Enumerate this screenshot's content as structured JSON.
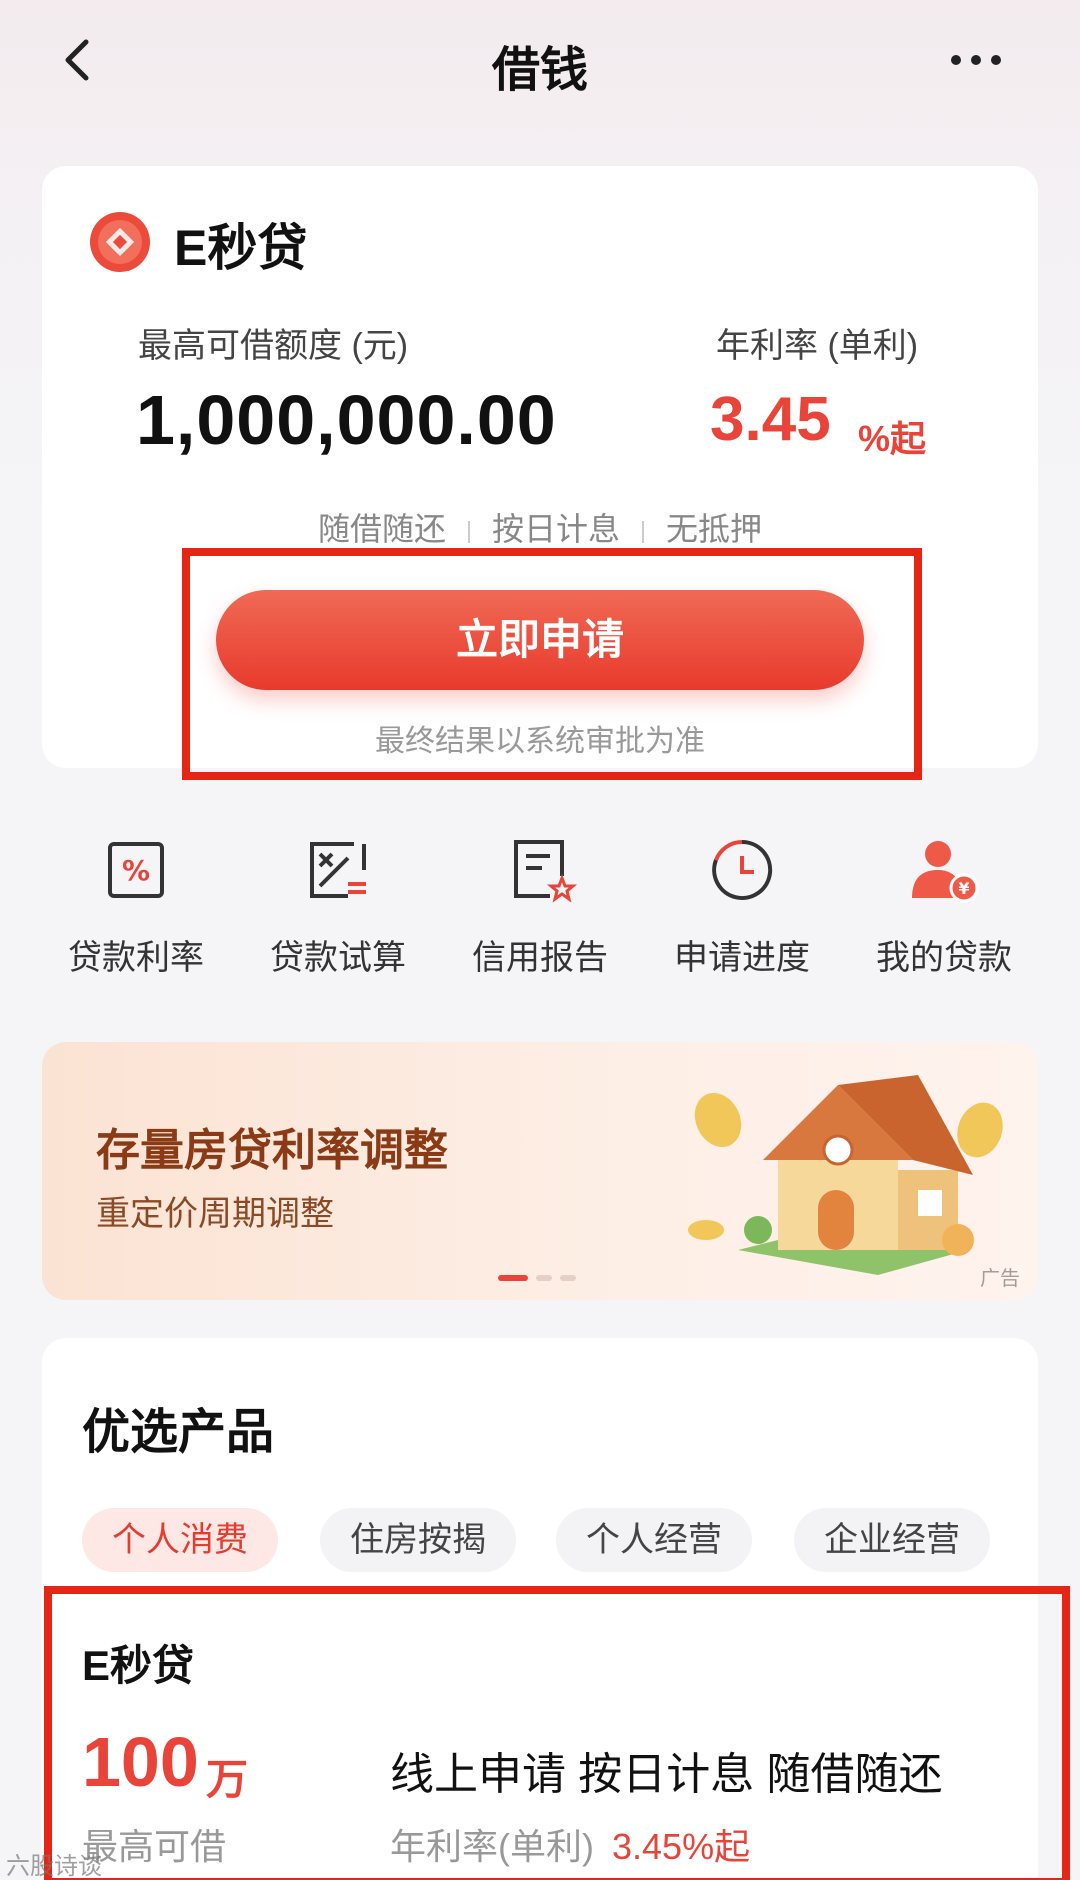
{
  "header": {
    "title": "借钱",
    "back_icon": "back-chevron-icon",
    "more_icon": "more-dots-icon"
  },
  "loan_card": {
    "product_name": "E秒贷",
    "limit_label": "最高可借额度 (元)",
    "limit_value": "1,000,000.00",
    "rate_label": "年利率 (单利)",
    "rate_value": "3.45",
    "rate_unit": "%起",
    "features": [
      "随借随还",
      "按日计息",
      "无抵押"
    ],
    "apply_button": "立即申请",
    "apply_note": "最终结果以系统审批为准"
  },
  "quick_actions": [
    {
      "label": "贷款利率",
      "icon": "percent-icon"
    },
    {
      "label": "贷款试算",
      "icon": "calculator-icon"
    },
    {
      "label": "信用报告",
      "icon": "report-icon"
    },
    {
      "label": "申请进度",
      "icon": "clock-icon"
    },
    {
      "label": "我的贷款",
      "icon": "user-money-icon"
    }
  ],
  "banner": {
    "title": "存量房贷利率调整",
    "subtitle": "重定价周期调整",
    "ad_tag": "广告",
    "pages": 3,
    "active_page": 1
  },
  "products": {
    "title": "优选产品",
    "tabs": [
      "个人消费",
      "住房按揭",
      "个人经营",
      "企业经营"
    ],
    "active_tab": 0,
    "card": {
      "name": "E秒贷",
      "amount": "100",
      "amount_unit": "万",
      "amount_label": "最高可借",
      "features": "线上申请 按日计息 随借随还",
      "rate_label": "年利率(单利)",
      "rate_value": "3.45%起"
    }
  },
  "watermark": "六股诗谈",
  "colors": {
    "accent": "#e8443a",
    "highlight_box": "#e62514"
  }
}
